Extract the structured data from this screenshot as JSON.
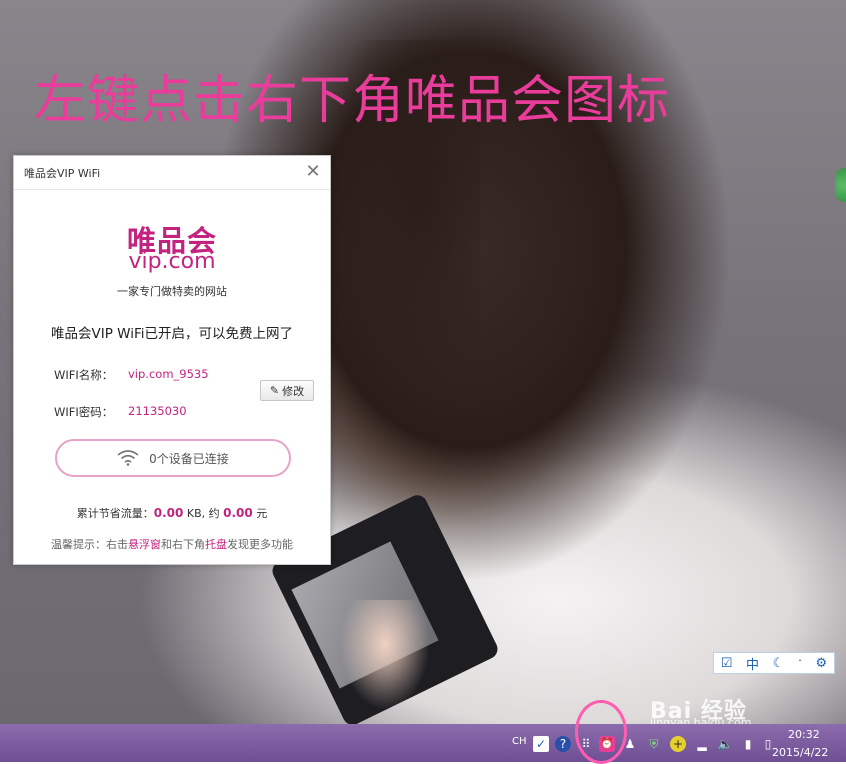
{
  "instruction_heading": "左键点击右下角唯品会图标",
  "popup": {
    "title": "唯品会VIP WiFi",
    "close_icon": "close-icon",
    "brand": {
      "logo_text": "唯品会",
      "domain": "vip.com",
      "tagline": "一家专门做特卖的网站"
    },
    "status_message": "唯品会VIP WiFi已开启，可以免费上网了",
    "wifi_name_label": "WIFI名称：",
    "wifi_name_value": "vip.com_9535",
    "wifi_password_label": "WIFI密码：",
    "wifi_password_value": "21135030",
    "edit_button_label": "修改",
    "devices_label": "0个设备已连接",
    "traffic": {
      "prefix": "累计节省流量：",
      "amount": "0.00",
      "unit": "KB, 约",
      "money": "0.00",
      "currency": "元"
    },
    "tip": {
      "prefix": "温馨提示：右击",
      "link1": "悬浮窗",
      "middle": "和右下角",
      "link2": "托盘",
      "suffix": "发现更多功能"
    }
  },
  "ime_toolbar": {
    "mode": "中",
    "items": [
      "check-icon",
      "中",
      "moon-icon",
      "punctuation-icon",
      "gear-icon"
    ]
  },
  "watermark": {
    "text": "Bai 经验",
    "sub": "jingyan.baidu.com"
  },
  "taskbar": {
    "language": "CH",
    "clock_time": "20:32",
    "clock_date": "2015/4/22"
  },
  "colors": {
    "accent": "#c3237f",
    "heading": "#ea3c9a",
    "taskbar": "#7a5aa0"
  }
}
